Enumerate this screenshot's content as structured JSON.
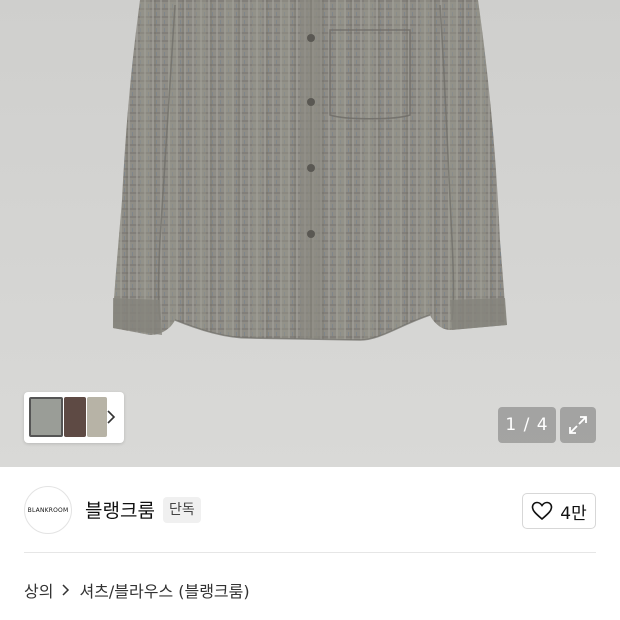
{
  "gallery": {
    "counter": "1 / 4",
    "thumbnail_colors": [
      "#9a9d97",
      "#5e4a44",
      "#b7b3a6"
    ]
  },
  "brand": {
    "logo_text": "BLANKROOM",
    "name": "블랭크룸",
    "exclusive_badge": "단독",
    "like_count": "4만"
  },
  "breadcrumb": {
    "category": "상의",
    "subcategory": "셔츠/블라우스 (블랭크룸)"
  },
  "colors": {
    "background": "#d4d4d2",
    "shirt": "#8e8c85",
    "overlay": "rgba(120,120,120,0.55)"
  }
}
